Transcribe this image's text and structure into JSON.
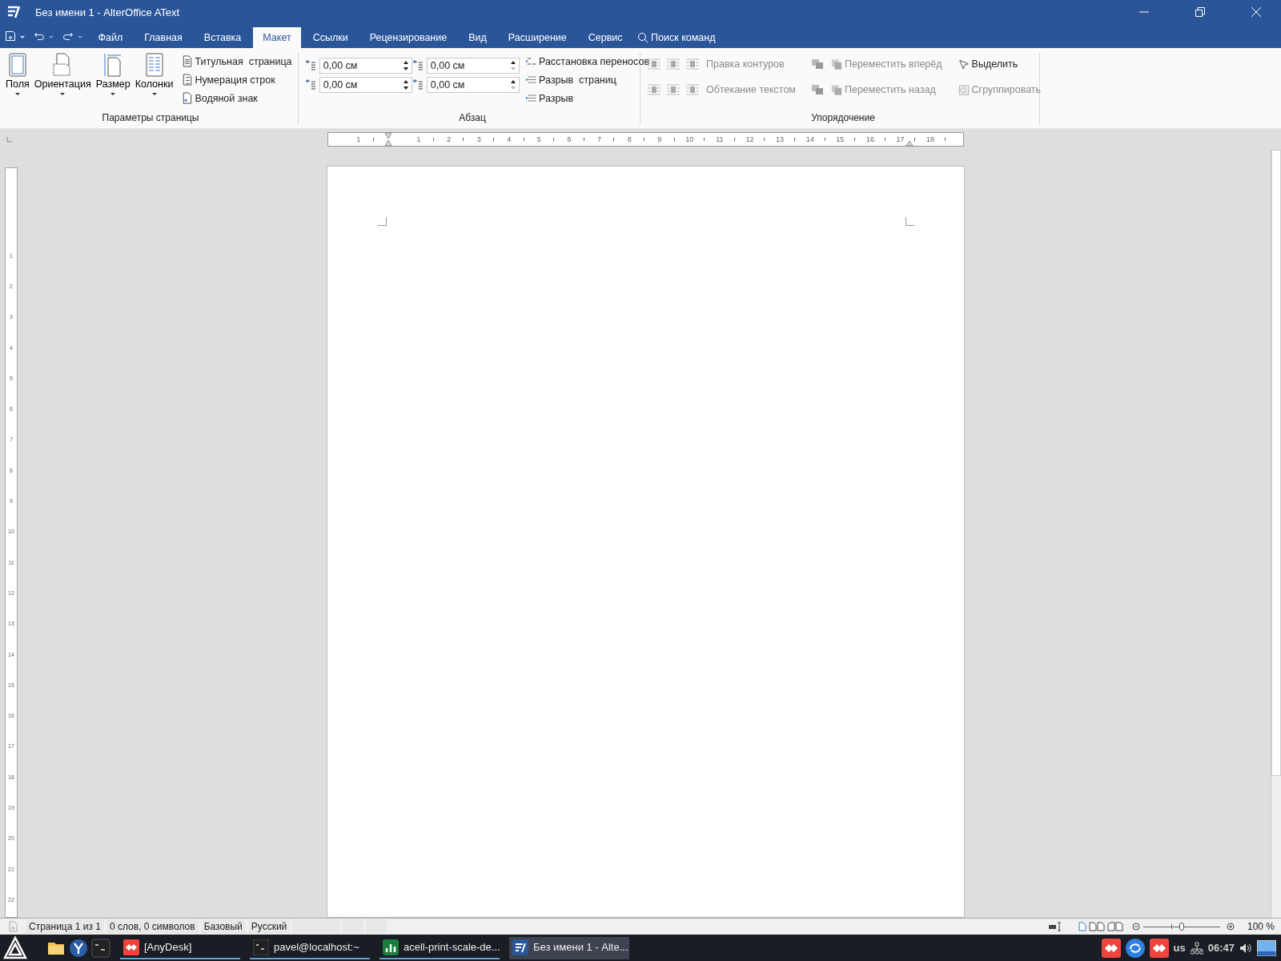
{
  "window": {
    "title": "Без имени 1 - AlterOffice AText"
  },
  "tabs": [
    {
      "label": "Файл",
      "selected": false
    },
    {
      "label": "Главная",
      "selected": false
    },
    {
      "label": "Вставка",
      "selected": false
    },
    {
      "label": "Макет",
      "selected": true
    },
    {
      "label": "Ссылки",
      "selected": false
    },
    {
      "label": "Рецензирование",
      "selected": false
    },
    {
      "label": "Вид",
      "selected": false
    },
    {
      "label": "Расширение",
      "selected": false
    },
    {
      "label": "Сервис",
      "selected": false
    }
  ],
  "command_search": {
    "label": "Поиск команд"
  },
  "page_setup": {
    "title": "Параметры страницы",
    "large_buttons": [
      "Поля",
      "Ориентация",
      "Размер",
      "Колонки"
    ],
    "small_buttons": [
      "Титульная  страница",
      "Нумерация строк",
      "Водяной знак"
    ]
  },
  "paragraph": {
    "title": "Абзац",
    "spin_fields": [
      {
        "value": "0,00 см"
      },
      {
        "value": "0,00 см"
      },
      {
        "value": "0,00 см"
      },
      {
        "value": "0,00 см"
      }
    ],
    "buttons": [
      "Расстановка переносов",
      "Разрыв  страниц",
      "Разрыв"
    ]
  },
  "arrange": {
    "title": "Упорядочение",
    "buttons": [
      {
        "label": "Правка контуров",
        "disabled": true
      },
      {
        "label": "Обтекание текстом",
        "disabled": true
      },
      {
        "label": "Переместить вперёд",
        "disabled": true
      },
      {
        "label": "Переместить назад",
        "disabled": true
      },
      {
        "label": "Выделить",
        "disabled": false
      },
      {
        "label": "Сгруппировать",
        "disabled": true
      }
    ]
  },
  "ruler": {
    "labels": [
      "1",
      "1",
      "2",
      "3",
      "4",
      "5",
      "6",
      "7",
      "8",
      "9",
      "10",
      "11",
      "12",
      "13",
      "14",
      "15",
      "16",
      "17",
      "18"
    ]
  },
  "vertical_ruler": {
    "labels": [
      "1",
      "2",
      "3",
      "4",
      "5",
      "6",
      "7",
      "8",
      "9",
      "10",
      "11",
      "12",
      "13",
      "14",
      "15",
      "16",
      "17",
      "18",
      "19",
      "20",
      "21",
      "22"
    ]
  },
  "status_bar": {
    "items": [
      "Страница 1 из 1",
      "0 слов, 0 символов",
      "Базовый",
      "Русский"
    ],
    "zoom": {
      "level": 0.5,
      "reading": "100 %"
    }
  },
  "taskbar": {
    "windows": [
      {
        "kind": "anydesk",
        "label": "[AnyDesk]",
        "selected": false
      },
      {
        "kind": "terminal",
        "label": "pavel@localhost:~",
        "selected": false
      },
      {
        "kind": "spreadsheet",
        "label": "acell-print-scale-de...",
        "selected": false
      },
      {
        "kind": "writer",
        "label": "Без имени 1 - Alte...",
        "selected": true
      }
    ],
    "keyboard_layout": "us",
    "clock": "06:47"
  }
}
